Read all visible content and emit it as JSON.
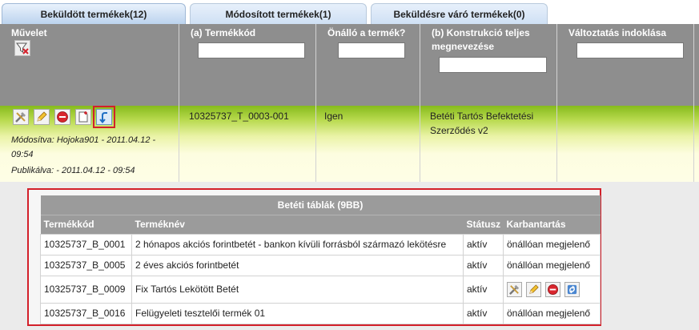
{
  "tabs": [
    {
      "label": "Beküldött termékek(12)",
      "active": true
    },
    {
      "label": "Módosított termékek(1)",
      "active": false
    },
    {
      "label": "Beküldésre váró termékek(0)",
      "active": false
    }
  ],
  "header": {
    "muvelet": "Művelet",
    "termekkod": "(a) Termékkód",
    "onallo": "Önálló a termék?",
    "konstrukcio": "(b) Konstrukció teljes megnevezése",
    "valtoztatas": "Változtatás indoklása"
  },
  "row": {
    "termekkod": "10325737_T_0003-001",
    "onallo": "Igen",
    "konstrukcio": "Betéti Tartós Befektetési Szerződés v2",
    "modositva": "Módosítva: Hojoka901 - 2011.04.12 - 09:54",
    "publikalva": "Publikálva: - 2011.04.12 - 09:54"
  },
  "subtable": {
    "caption": "Betéti táblák (9BB)",
    "columns": [
      "Termékkód",
      "Terméknév",
      "Státusz",
      "Karbantartás"
    ],
    "rows": [
      {
        "kod": "10325737_B_0001",
        "nev": "2 hónapos akciós forintbetét - bankon kívüli forrásból származó lekötésre",
        "statusz": "aktív",
        "karbantartas": "önállóan megjelenő"
      },
      {
        "kod": "10325737_B_0005",
        "nev": "2 éves akciós forintbetét",
        "statusz": "aktív",
        "karbantartas": "önállóan megjelenő"
      },
      {
        "kod": "10325737_B_0009",
        "nev": "Fix Tartós Lekötött Betét",
        "statusz": "aktív",
        "karbantartas": ""
      },
      {
        "kod": "10325737_B_0016",
        "nev": "Felügyeleti tesztelői termék 01",
        "statusz": "aktív",
        "karbantartas": "önállóan megjelenő"
      }
    ]
  },
  "colors": {
    "highlight": "#d3202a",
    "row_green": "#86bb1c",
    "header_gray": "#8e8e8e"
  },
  "icons": [
    "filter-clear-icon",
    "tools-icon",
    "pencil-icon",
    "delete-icon",
    "new-document-icon",
    "return-arrow-icon",
    "refresh-icon"
  ]
}
